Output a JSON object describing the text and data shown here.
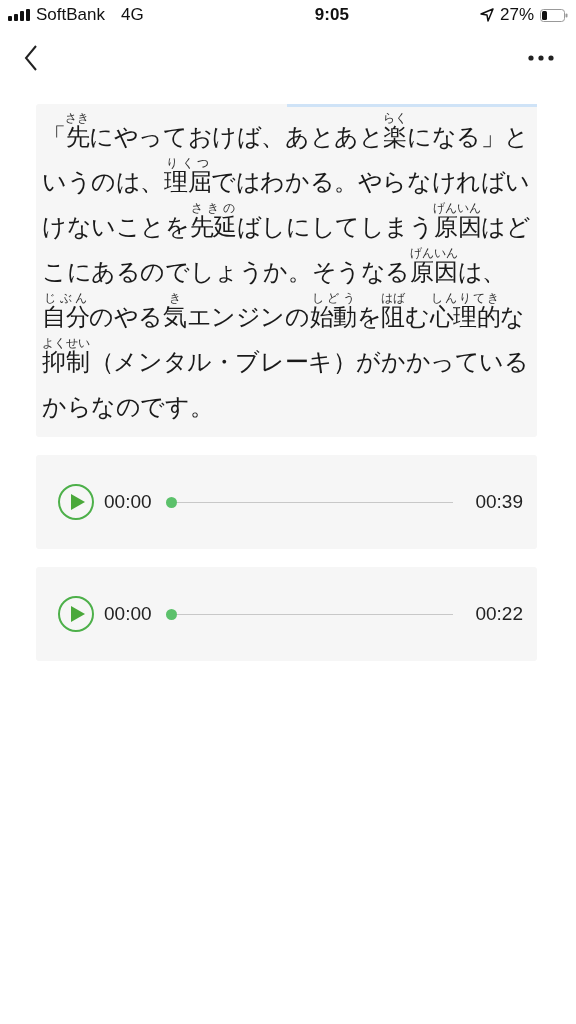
{
  "status_bar": {
    "carrier": "SoftBank",
    "network": "4G",
    "time": "9:05",
    "battery": "27%"
  },
  "passage": [
    {
      "text": "「"
    },
    {
      "base": "先",
      "ruby": "さき"
    },
    {
      "text": "にやっておけば、あとあと"
    },
    {
      "base": "楽",
      "ruby": "らく"
    },
    {
      "text": "になる」というのは、"
    },
    {
      "base": "理屈",
      "ruby": "りくつ"
    },
    {
      "text": "ではわかる。やらなければいけないことを"
    },
    {
      "base": "先延",
      "ruby": "さきの"
    },
    {
      "text": "ばしにしてしまう"
    },
    {
      "base": "原因",
      "ruby": "げんいん"
    },
    {
      "text": "はどこにあるのでしょうか。そうなる"
    },
    {
      "base": "原因",
      "ruby": "げんいん"
    },
    {
      "text": "は、"
    },
    {
      "base": "自分",
      "ruby": "じぶん"
    },
    {
      "text": "のやる"
    },
    {
      "base": "気",
      "ruby": "き"
    },
    {
      "text": "エンジンの"
    },
    {
      "base": "始動",
      "ruby": "しどう"
    },
    {
      "text": "を"
    },
    {
      "base": "阻",
      "ruby": "はば"
    },
    {
      "text": "む"
    },
    {
      "base": "心理的",
      "ruby": "しんりてき"
    },
    {
      "text": "な"
    },
    {
      "base": "抑制",
      "ruby": "よくせい"
    },
    {
      "text": "（メンタル・ブレーキ）がかかっているからなのです。"
    }
  ],
  "audio": [
    {
      "current": "00:00",
      "duration": "00:39",
      "level": 0
    },
    {
      "current": "00:00",
      "duration": "00:22",
      "level": 0
    }
  ]
}
